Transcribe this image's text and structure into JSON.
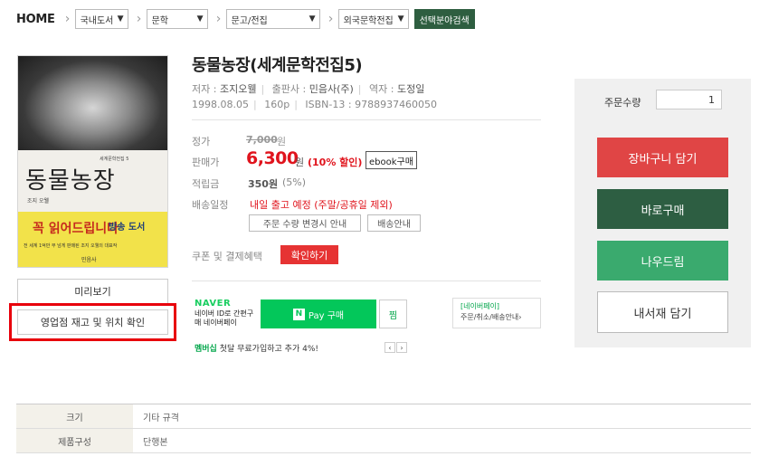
{
  "breadcrumb": {
    "home": "HOME",
    "selects": [
      "국내도서",
      "문학",
      "문고/전집",
      "외국문학전집"
    ],
    "search_button": "선택분야검색"
  },
  "cover": {
    "series": "세계문학전집 5",
    "title": "동물농장",
    "author": "조지 오웰",
    "badge_main": "꼭 읽어드립니다",
    "badge_side": "방송 도서",
    "caption": "전 세계 1억만 부 넘게 판매된 조지 오웰의 대표작",
    "publisher": "민음사"
  },
  "left_buttons": {
    "preview": "미리보기",
    "store_stock": "영업점 재고 및 위치 확인"
  },
  "product": {
    "title": "동물농장(세계문학전집5)",
    "author_label": "저자 :",
    "author": "조지오웰",
    "publisher_label": "출판사 :",
    "publisher": "민음사(주)",
    "translator_label": "역자 :",
    "translator": "도정일",
    "date": "1998.08.05",
    "pages": "160p",
    "isbn": "ISBN-13 : 9788937460050"
  },
  "price": {
    "list_label": "정가",
    "list_price": "7,000",
    "won": "원",
    "sale_label": "판매가",
    "sale_price": "6,300",
    "discount": "(10% 할인)",
    "ebook_button": "ebook구매",
    "points_label": "적립금",
    "points": "350원",
    "points_pct": "(5%)",
    "shipping_label": "배송일정",
    "shipping": "내일 출고 예정  (주말/공휴일 제외)",
    "notice_button": "주문 수량 변경시 안내",
    "shipping_button": "배송안내",
    "coupon_label": "쿠폰 및 결제혜택",
    "coupon_button": "확인하기"
  },
  "naver": {
    "logo": "NAVER",
    "text": "네이버 ID로 간편구매 네이버페이",
    "pay_n": "N",
    "pay_button": "Pay 구매",
    "zzim": "찜",
    "box_title": "[네이버페이]",
    "box_text": "주문/취소/배송안내›",
    "member_bold": "멤버십",
    "member_text": " 첫달 무료가입하고 추가 4%!",
    "pager_prev": "‹",
    "pager_next": "›"
  },
  "order_panel": {
    "qty_label": "주문수량",
    "qty": "1",
    "cart": "장바구니 담기",
    "buy_now": "바로구매",
    "dream": "나우드림",
    "my_library": "내서재 담기"
  },
  "specs": [
    {
      "label": "크기",
      "value": "기타 규격"
    },
    {
      "label": "제품구성",
      "value": "단행본"
    }
  ]
}
